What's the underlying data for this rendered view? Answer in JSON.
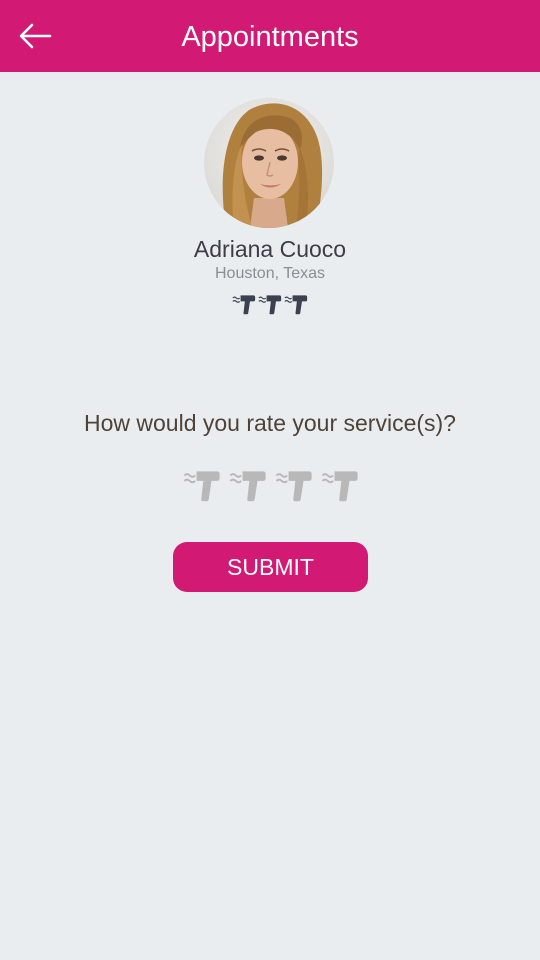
{
  "header": {
    "title": "Appointments",
    "back_icon": "arrow-left-icon",
    "background_color": "#d21973"
  },
  "stylist": {
    "avatar_icon": "profile-photo",
    "name": "Adriana Cuoco",
    "location": "Houston, Texas",
    "rating_icon": "hair-dryer-icon",
    "rating_value": 3,
    "rating_max": 3,
    "rating_color": "#3b4150"
  },
  "feedback": {
    "prompt": "How would you rate your service(s)?",
    "rating_icon": "hair-dryer-icon",
    "rating_value": 0,
    "rating_max": 4,
    "empty_color": "#b8b8b8",
    "submit_label": "SUBMIT"
  },
  "colors": {
    "accent": "#d21973",
    "background": "#e9edf0"
  }
}
